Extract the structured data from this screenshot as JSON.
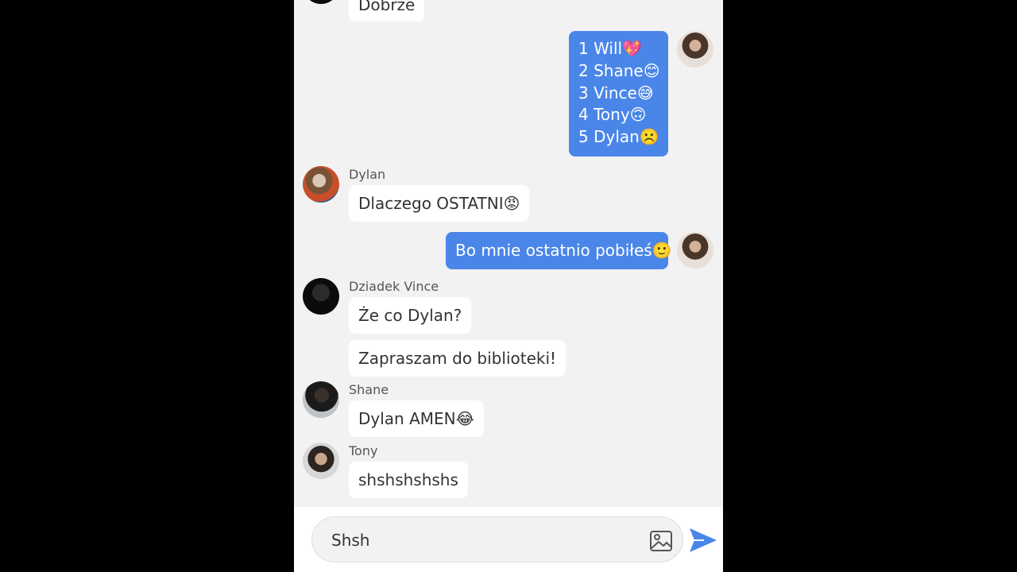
{
  "messages": {
    "prev": {
      "text": "Dobrze"
    },
    "list": {
      "lines": [
        "1 Will💖",
        "2 Shane😊",
        "3 Vince😅",
        "4 Tony🙃",
        "5 Dylan☹️"
      ]
    },
    "dylan": {
      "sender": "Dylan",
      "text": "Dlaczego OSTATNI😡"
    },
    "me_reply": {
      "text": "Bo mnie ostatnio pobiłeś🙂"
    },
    "vince": {
      "sender": "Dziadek Vince",
      "text1": "Że co Dylan?",
      "text2": "Zapraszam do biblioteki!"
    },
    "shane": {
      "sender": "Shane",
      "text": "Dylan AMEN😂"
    },
    "tony": {
      "sender": "Tony",
      "text": "shshshshshs"
    }
  },
  "composer": {
    "value": "Shsh",
    "image_icon": "image-icon",
    "send_icon": "send-icon"
  },
  "colors": {
    "outgoing": "#4a86e8",
    "incoming": "#ffffff",
    "background": "#f2f2f2"
  }
}
